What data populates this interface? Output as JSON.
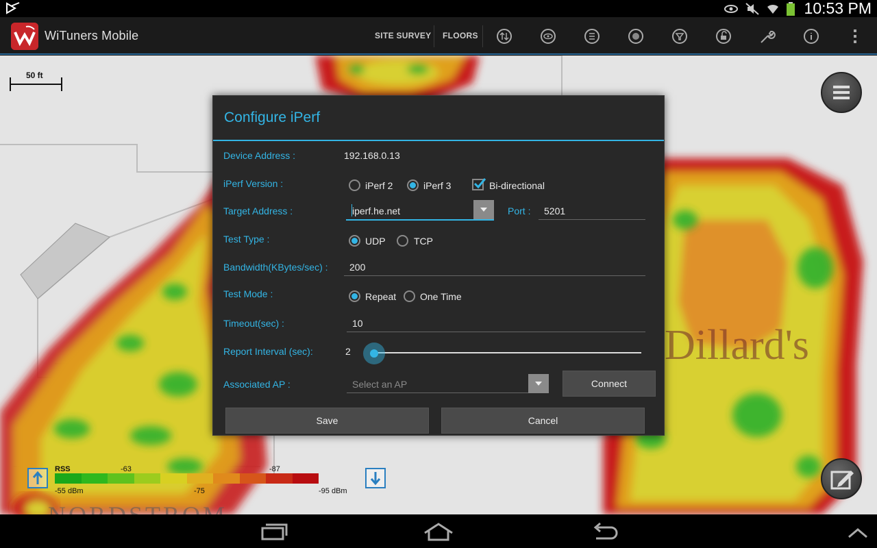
{
  "status_bar": {
    "time": "10:53 PM"
  },
  "action_bar": {
    "app_title": "WiTuners Mobile",
    "menu_site_survey": "SITE SURVEY",
    "menu_floors": "FLOORS",
    "icons": [
      "sort-icon",
      "eye-icon",
      "list-icon",
      "target-icon",
      "filter-icon",
      "unlock-icon",
      "wrench-icon",
      "info-icon",
      "overflow-menu-icon"
    ]
  },
  "map": {
    "scale_label": "50 ft",
    "store_label": "Dillard's",
    "bottom_label": "NORDSTROM",
    "legend": {
      "title": "RSS",
      "top_values": [
        "-63",
        "-87"
      ],
      "bottom_values": [
        "-55 dBm",
        "-75",
        "-95 dBm"
      ],
      "colors": [
        "#1aa81a",
        "#2fb81e",
        "#5fc21e",
        "#9ccc1e",
        "#d8d022",
        "#e0b020",
        "#e08a1c",
        "#d6561a",
        "#c82a16",
        "#b80d10"
      ]
    }
  },
  "dialog": {
    "title": "Configure iPerf",
    "device_address": {
      "label": "Device Address :",
      "value": "192.168.0.13"
    },
    "iperf_version": {
      "label": "iPerf Version :",
      "options": [
        "iPerf 2",
        "iPerf 3"
      ],
      "selected": "iPerf 3",
      "bidirectional_label": "Bi-directional",
      "bidirectional_checked": true
    },
    "target_address": {
      "label": "Target Address :",
      "value": "iperf.he.net",
      "port_label": "Port :",
      "port_value": "5201"
    },
    "test_type": {
      "label": "Test Type :",
      "options": [
        "UDP",
        "TCP"
      ],
      "selected": "UDP"
    },
    "bandwidth": {
      "label": "Bandwidth(KBytes/sec) :",
      "value": "200"
    },
    "test_mode": {
      "label": "Test Mode :",
      "options": [
        "Repeat",
        "One Time"
      ],
      "selected": "Repeat"
    },
    "timeout": {
      "label": "Timeout(sec) :",
      "value": "10"
    },
    "report_interval": {
      "label": "Report Interval (sec):",
      "value": "2",
      "slider_fraction": 0.0
    },
    "associated_ap": {
      "label": "Associated AP :",
      "placeholder": "Select an AP",
      "connect_label": "Connect"
    },
    "save_label": "Save",
    "cancel_label": "Cancel"
  }
}
